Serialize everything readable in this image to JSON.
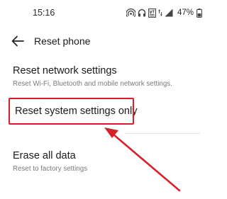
{
  "status_bar": {
    "time": "15:16",
    "battery_percent": "47%",
    "icons": [
      "hotspot-icon",
      "headphones-icon",
      "volte-icon",
      "data-arrows-icon",
      "signal-icon",
      "battery-icon"
    ]
  },
  "header": {
    "back_icon": "arrow-left-icon",
    "title": "Reset phone"
  },
  "items": [
    {
      "title": "Reset network settings",
      "subtitle": "Reset Wi-Fi, Bluetooth and mobile network settings."
    },
    {
      "title": "Reset system settings only"
    },
    {
      "title": "Erase all data",
      "subtitle": "Reset to factory settings"
    }
  ],
  "annotation": {
    "color": "#d6202a",
    "highlighted_item": "Reset system settings only"
  }
}
